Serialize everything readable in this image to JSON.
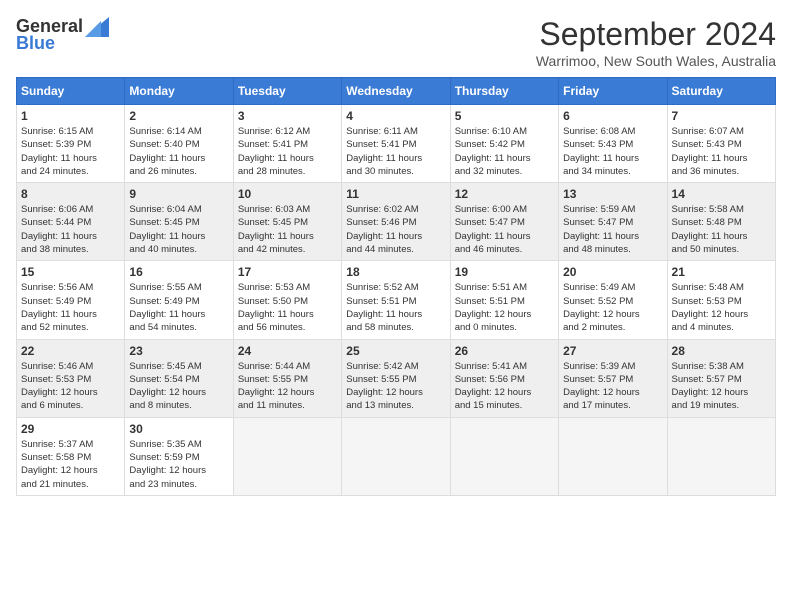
{
  "logo": {
    "general": "General",
    "blue": "Blue"
  },
  "title": "September 2024",
  "subtitle": "Warrimoo, New South Wales, Australia",
  "weekdays": [
    "Sunday",
    "Monday",
    "Tuesday",
    "Wednesday",
    "Thursday",
    "Friday",
    "Saturday"
  ],
  "weeks": [
    [
      {
        "day": "1",
        "sunrise": "6:15 AM",
        "sunset": "5:39 PM",
        "daylight": "11 hours and 24 minutes."
      },
      {
        "day": "2",
        "sunrise": "6:14 AM",
        "sunset": "5:40 PM",
        "daylight": "11 hours and 26 minutes."
      },
      {
        "day": "3",
        "sunrise": "6:12 AM",
        "sunset": "5:41 PM",
        "daylight": "11 hours and 28 minutes."
      },
      {
        "day": "4",
        "sunrise": "6:11 AM",
        "sunset": "5:41 PM",
        "daylight": "11 hours and 30 minutes."
      },
      {
        "day": "5",
        "sunrise": "6:10 AM",
        "sunset": "5:42 PM",
        "daylight": "11 hours and 32 minutes."
      },
      {
        "day": "6",
        "sunrise": "6:08 AM",
        "sunset": "5:43 PM",
        "daylight": "11 hours and 34 minutes."
      },
      {
        "day": "7",
        "sunrise": "6:07 AM",
        "sunset": "5:43 PM",
        "daylight": "11 hours and 36 minutes."
      }
    ],
    [
      {
        "day": "8",
        "sunrise": "6:06 AM",
        "sunset": "5:44 PM",
        "daylight": "11 hours and 38 minutes."
      },
      {
        "day": "9",
        "sunrise": "6:04 AM",
        "sunset": "5:45 PM",
        "daylight": "11 hours and 40 minutes."
      },
      {
        "day": "10",
        "sunrise": "6:03 AM",
        "sunset": "5:45 PM",
        "daylight": "11 hours and 42 minutes."
      },
      {
        "day": "11",
        "sunrise": "6:02 AM",
        "sunset": "5:46 PM",
        "daylight": "11 hours and 44 minutes."
      },
      {
        "day": "12",
        "sunrise": "6:00 AM",
        "sunset": "5:47 PM",
        "daylight": "11 hours and 46 minutes."
      },
      {
        "day": "13",
        "sunrise": "5:59 AM",
        "sunset": "5:47 PM",
        "daylight": "11 hours and 48 minutes."
      },
      {
        "day": "14",
        "sunrise": "5:58 AM",
        "sunset": "5:48 PM",
        "daylight": "11 hours and 50 minutes."
      }
    ],
    [
      {
        "day": "15",
        "sunrise": "5:56 AM",
        "sunset": "5:49 PM",
        "daylight": "11 hours and 52 minutes."
      },
      {
        "day": "16",
        "sunrise": "5:55 AM",
        "sunset": "5:49 PM",
        "daylight": "11 hours and 54 minutes."
      },
      {
        "day": "17",
        "sunrise": "5:53 AM",
        "sunset": "5:50 PM",
        "daylight": "11 hours and 56 minutes."
      },
      {
        "day": "18",
        "sunrise": "5:52 AM",
        "sunset": "5:51 PM",
        "daylight": "11 hours and 58 minutes."
      },
      {
        "day": "19",
        "sunrise": "5:51 AM",
        "sunset": "5:51 PM",
        "daylight": "12 hours and 0 minutes."
      },
      {
        "day": "20",
        "sunrise": "5:49 AM",
        "sunset": "5:52 PM",
        "daylight": "12 hours and 2 minutes."
      },
      {
        "day": "21",
        "sunrise": "5:48 AM",
        "sunset": "5:53 PM",
        "daylight": "12 hours and 4 minutes."
      }
    ],
    [
      {
        "day": "22",
        "sunrise": "5:46 AM",
        "sunset": "5:53 PM",
        "daylight": "12 hours and 6 minutes."
      },
      {
        "day": "23",
        "sunrise": "5:45 AM",
        "sunset": "5:54 PM",
        "daylight": "12 hours and 8 minutes."
      },
      {
        "day": "24",
        "sunrise": "5:44 AM",
        "sunset": "5:55 PM",
        "daylight": "12 hours and 11 minutes."
      },
      {
        "day": "25",
        "sunrise": "5:42 AM",
        "sunset": "5:55 PM",
        "daylight": "12 hours and 13 minutes."
      },
      {
        "day": "26",
        "sunrise": "5:41 AM",
        "sunset": "5:56 PM",
        "daylight": "12 hours and 15 minutes."
      },
      {
        "day": "27",
        "sunrise": "5:39 AM",
        "sunset": "5:57 PM",
        "daylight": "12 hours and 17 minutes."
      },
      {
        "day": "28",
        "sunrise": "5:38 AM",
        "sunset": "5:57 PM",
        "daylight": "12 hours and 19 minutes."
      }
    ],
    [
      {
        "day": "29",
        "sunrise": "5:37 AM",
        "sunset": "5:58 PM",
        "daylight": "12 hours and 21 minutes."
      },
      {
        "day": "30",
        "sunrise": "5:35 AM",
        "sunset": "5:59 PM",
        "daylight": "12 hours and 23 minutes."
      },
      null,
      null,
      null,
      null,
      null
    ]
  ],
  "labels": {
    "sunrise": "Sunrise: ",
    "sunset": "Sunset: ",
    "daylight": "Daylight: "
  }
}
